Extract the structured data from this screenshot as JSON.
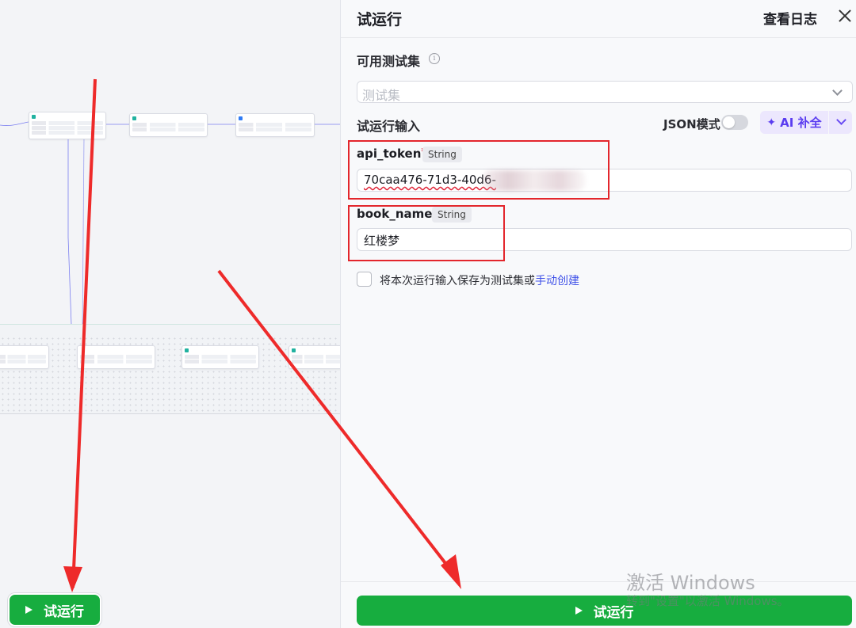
{
  "panel": {
    "title": "试运行",
    "log_label": "查看日志",
    "test_set_label": "可用测试集",
    "info_icon_glyph": "i",
    "test_set_placeholder": "测试集",
    "run_input_label": "试运行输入",
    "json_mode_label": "JSON模式",
    "json_mode_on": false,
    "ai_fill_label": "AI 补全",
    "fields": [
      {
        "name": "api_token",
        "required_mark": "*",
        "type": "String",
        "value": "70caa476-71d3-40d6-"
      },
      {
        "name": "book_name",
        "required_mark": "*",
        "type": "String",
        "value": "红楼梦"
      }
    ],
    "save_text": "将本次运行输入保存为测试集或",
    "save_link": "手动创建",
    "run_button": "试运行"
  },
  "canvas": {
    "run_button": "试运行"
  },
  "watermark": {
    "line1": "激活 Windows",
    "line2": "转到\"设置\"以激活 Windows。"
  },
  "colors": {
    "run_green": "#17ad3f",
    "ai_purple": "#5a3cf0",
    "annotation_red": "#e3262c",
    "link_blue": "#3f51e8"
  }
}
